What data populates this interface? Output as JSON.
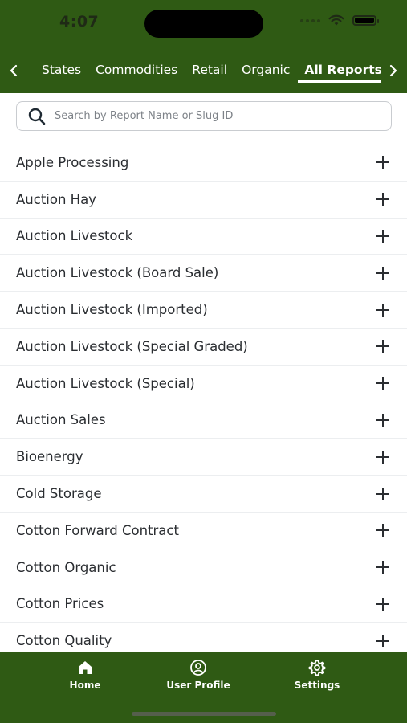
{
  "status_bar": {
    "time": "4:07"
  },
  "tabs": [
    {
      "label": "States"
    },
    {
      "label": "Commodities"
    },
    {
      "label": "Retail"
    },
    {
      "label": "Organic"
    },
    {
      "label": "All Reports"
    }
  ],
  "active_tab": "All Reports",
  "search": {
    "placeholder": "Search by Report Name or Slug ID",
    "value": ""
  },
  "reports": [
    {
      "label": "Apple Processing"
    },
    {
      "label": "Auction Hay"
    },
    {
      "label": "Auction Livestock"
    },
    {
      "label": "Auction Livestock (Board Sale)"
    },
    {
      "label": "Auction Livestock (Imported)"
    },
    {
      "label": "Auction Livestock (Special Graded)"
    },
    {
      "label": "Auction Livestock (Special)"
    },
    {
      "label": "Auction Sales"
    },
    {
      "label": "Bioenergy"
    },
    {
      "label": "Cold Storage"
    },
    {
      "label": "Cotton Forward Contract"
    },
    {
      "label": "Cotton Organic"
    },
    {
      "label": "Cotton Prices"
    },
    {
      "label": "Cotton Quality"
    }
  ],
  "bottom_nav": {
    "home": {
      "label": "Home",
      "icon": "home-icon"
    },
    "profile": {
      "label": "User Profile",
      "icon": "user-profile-icon"
    },
    "settings": {
      "label": "Settings",
      "icon": "settings-icon"
    }
  },
  "colors": {
    "brand_green": "#2f5a14",
    "text": "#2a2d31"
  }
}
